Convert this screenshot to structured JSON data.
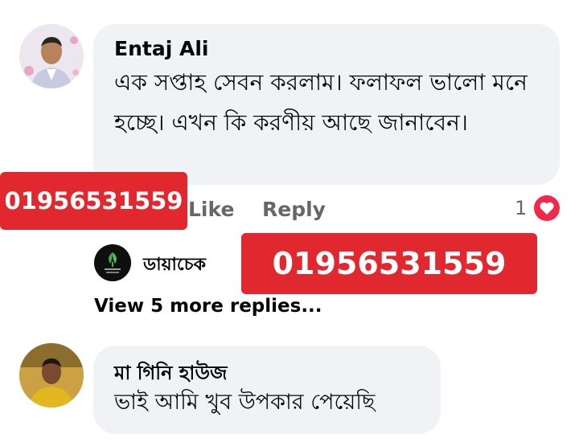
{
  "comments": [
    {
      "author": "Entaj Ali",
      "text": "এক সপ্তাহ সেবন করলাম। ফলাফল ভালো মনে হচ্ছে। এখন কি করণীয় আছে জানাবেন।",
      "actions": {
        "like": "Like",
        "reply": "Reply"
      },
      "reaction_count": "1",
      "reaction_icon": "heart-icon"
    },
    {
      "author": "মা গিনি হাউজ",
      "text": "ভাই আমি খুব উপকার পেয়েছি"
    }
  ],
  "reply_preview": {
    "author": "ডায়াচেক"
  },
  "more_replies_label": "View 5 more replies...",
  "overlay_labels": {
    "phone_small": "01956531559",
    "phone_large": "01956531559"
  },
  "colors": {
    "bubble": "#f0f2f5",
    "overlay_red": "#e0282e",
    "heart": "#f02849",
    "muted_text": "#65676b"
  }
}
